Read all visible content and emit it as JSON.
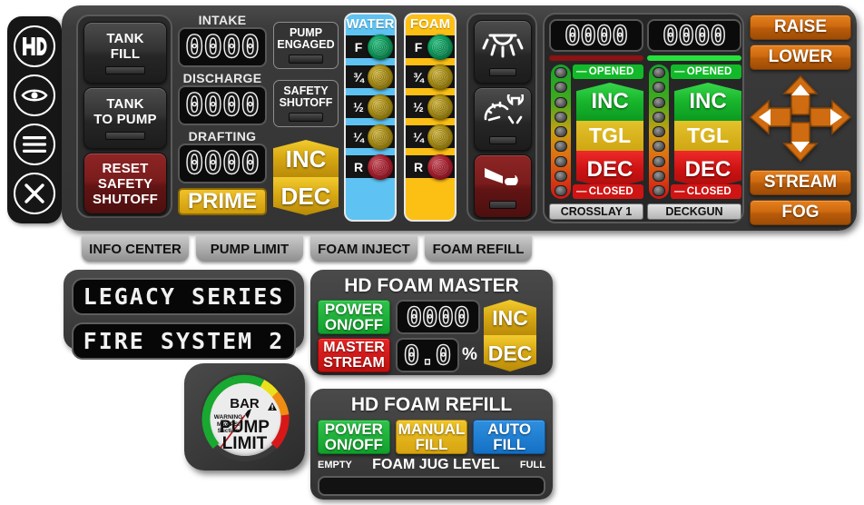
{
  "rail": {
    "items": [
      {
        "name": "hd-logo-icon",
        "label": "HD"
      },
      {
        "name": "eye-icon",
        "label": ""
      },
      {
        "name": "menu-icon",
        "label": ""
      },
      {
        "name": "close-icon",
        "label": ""
      }
    ]
  },
  "panel": {
    "left_buttons": [
      {
        "label_line1": "TANK",
        "label_line2": "FILL",
        "style": "dark"
      },
      {
        "label_line1": "TANK",
        "label_line2": "TO PUMP",
        "style": "dark"
      },
      {
        "label_line1": "RESET",
        "label_line2": "SAFETY",
        "label_line3": "SHUTOFF",
        "style": "red"
      }
    ],
    "readouts": [
      {
        "label": "INTAKE",
        "value": "0000"
      },
      {
        "label": "DISCHARGE",
        "value": "0000"
      },
      {
        "label": "DRAFTING",
        "value": "0000"
      }
    ],
    "prime_label": "PRIME",
    "status": [
      {
        "line1": "PUMP",
        "line2": "ENGAGED"
      },
      {
        "line1": "SAFETY",
        "line2": "SHUTOFF"
      }
    ],
    "pump_inc": "INC",
    "pump_dec": "DEC",
    "levels": [
      {
        "title": "WATER",
        "accent": "#5ec3f2",
        "rows": [
          {
            "tick": "F",
            "led": "green"
          },
          {
            "tick": "¾",
            "led": "amber"
          },
          {
            "tick": "½",
            "led": "amber"
          },
          {
            "tick": "¼",
            "led": "amber"
          },
          {
            "tick": "R",
            "led": "red"
          }
        ]
      },
      {
        "title": "FOAM",
        "accent": "#fcbf14",
        "rows": [
          {
            "tick": "F",
            "led": "green"
          },
          {
            "tick": "¾",
            "led": "amber"
          },
          {
            "tick": "½",
            "led": "amber"
          },
          {
            "tick": "¼",
            "led": "amber"
          },
          {
            "tick": "R",
            "led": "red"
          }
        ]
      }
    ],
    "icon_buttons": [
      {
        "name": "scene-light-icon",
        "style": "dark"
      },
      {
        "name": "pressure-gauge-light-icon",
        "style": "dark"
      },
      {
        "name": "horn-icon",
        "style": "red"
      }
    ],
    "valves": [
      {
        "name": "CROSSLAY 1",
        "value": "0000",
        "bar_color": "#8a1313",
        "opened_label": "OPENED",
        "closed_label": "CLOSED",
        "inc": "INC",
        "tgl": "TGL",
        "dec": "DEC"
      },
      {
        "name": "DECKGUN",
        "value": "0000",
        "bar_color": "#26e03c",
        "opened_label": "OPENED",
        "closed_label": "CLOSED",
        "inc": "INC",
        "tgl": "TGL",
        "dec": "DEC"
      }
    ],
    "nozzle": {
      "raise": "RAISE",
      "lower": "LOWER",
      "stream": "STREAM",
      "fog": "FOG",
      "accent": "#cf6b10"
    }
  },
  "tabs": [
    {
      "label": "INFO CENTER"
    },
    {
      "label": "PUMP LIMIT"
    },
    {
      "label": "FOAM INJECT"
    },
    {
      "label": "FOAM REFILL"
    }
  ],
  "marquee": {
    "line1": "LEGACY SERIES",
    "line2": "FIRE SYSTEM 2"
  },
  "foam_master": {
    "title": "HD FOAM MASTER",
    "power_line1": "POWER",
    "power_line2": "ON/OFF",
    "master_line1": "MASTER",
    "master_line2": "STREAM",
    "flow_value": "0000",
    "pct_value": "0.0",
    "pct_symbol": "%",
    "inc": "INC",
    "dec": "DEC"
  },
  "foam_refill": {
    "title": "HD FOAM REFILL",
    "power_line1": "POWER",
    "power_line2": "ON/OFF",
    "manual_line1": "MANUAL",
    "manual_line2": "FILL",
    "auto_line1": "AUTO",
    "auto_line2": "FILL",
    "empty_label": "EMPTY",
    "jug_label": "FOAM JUG LEVEL",
    "full_label": "FULL",
    "jug_fill_pct": 0
  },
  "gauge": {
    "unit": "BAR",
    "warning_line1": "WARNING",
    "warning_line2": "Max PSI",
    "warning_line3": "Suction",
    "caption_line1": "PUMP",
    "caption_line2": "LIMIT",
    "needle_deg": -52
  }
}
